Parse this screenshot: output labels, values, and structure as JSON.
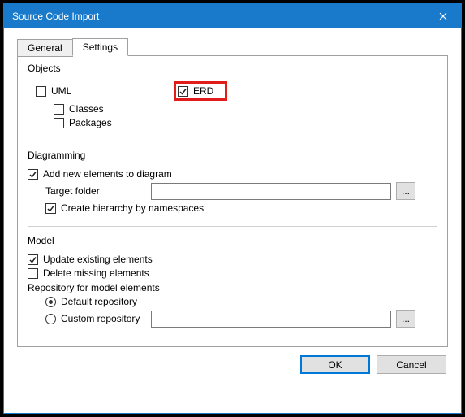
{
  "window": {
    "title": "Source Code Import"
  },
  "tabs": {
    "general": "General",
    "settings": "Settings"
  },
  "objects": {
    "legend": "Objects",
    "uml": "UML",
    "classes": "Classes",
    "packages": "Packages",
    "erd": "ERD"
  },
  "diagramming": {
    "legend": "Diagramming",
    "addNew": "Add new elements to diagram",
    "targetFolder": "Target folder",
    "createHierarchy": "Create hierarchy by namespaces",
    "browse": "..."
  },
  "model": {
    "legend": "Model",
    "updateExisting": "Update existing elements",
    "deleteMissing": "Delete missing elements",
    "repoLegend": "Repository for model elements",
    "defaultRepo": "Default repository",
    "customRepo": "Custom repository",
    "browse": "..."
  },
  "footer": {
    "ok": "OK",
    "cancel": "Cancel"
  }
}
